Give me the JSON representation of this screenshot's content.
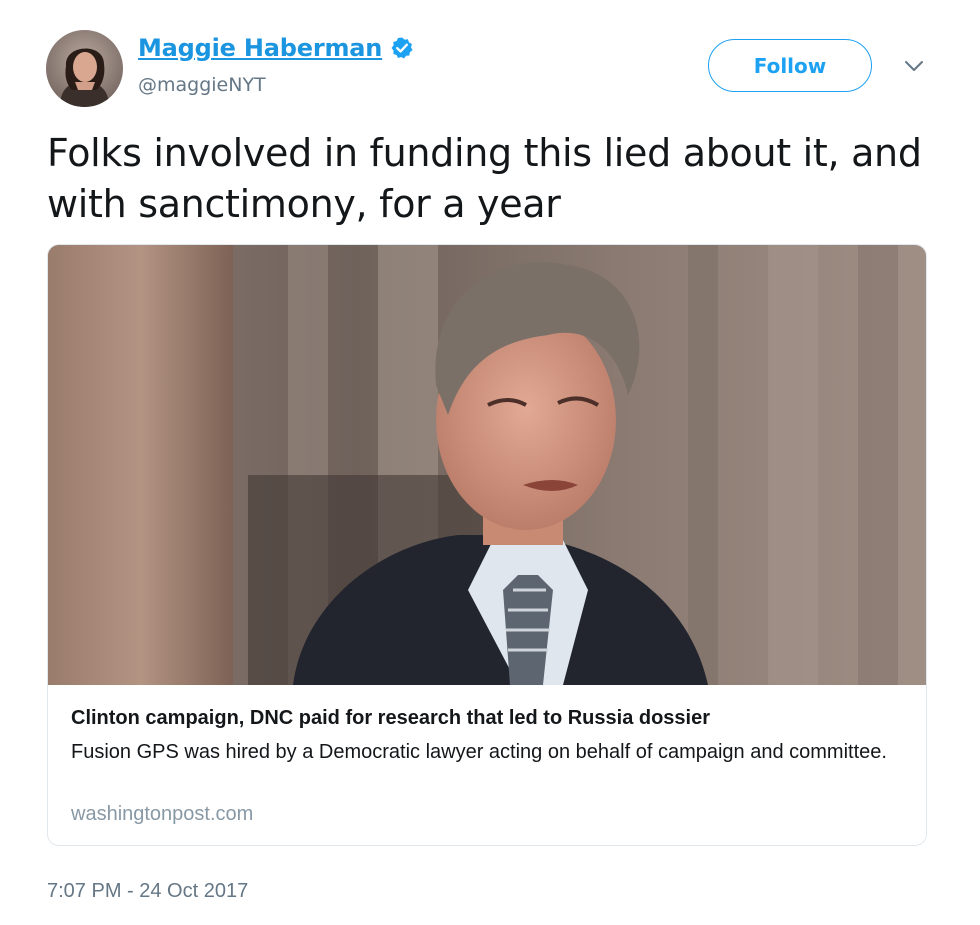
{
  "author": {
    "display_name": "Maggie Haberman",
    "handle": "@maggieNYT",
    "verified": true,
    "avatar_icon": "profile-photo"
  },
  "header": {
    "follow_label": "Follow",
    "menu_icon": "chevron-down-icon"
  },
  "tweet": {
    "text": "Folks involved in funding this lied about it, and with sanctimony, for a year",
    "timestamp": "7:07 PM - 24 Oct 2017"
  },
  "card": {
    "image_icon": "news-photo",
    "title": "Clinton campaign, DNC paid for research that led to Russia dossier",
    "description": "Fusion GPS was hired by a Democratic lawyer acting on behalf of campaign and committee.",
    "domain": "washingtonpost.com"
  },
  "colors": {
    "accent": "#1da1f2",
    "name_link": "#1b95e0",
    "secondary_text": "#657786",
    "domain_text": "#8899a6",
    "card_border": "#e1e8ed"
  }
}
